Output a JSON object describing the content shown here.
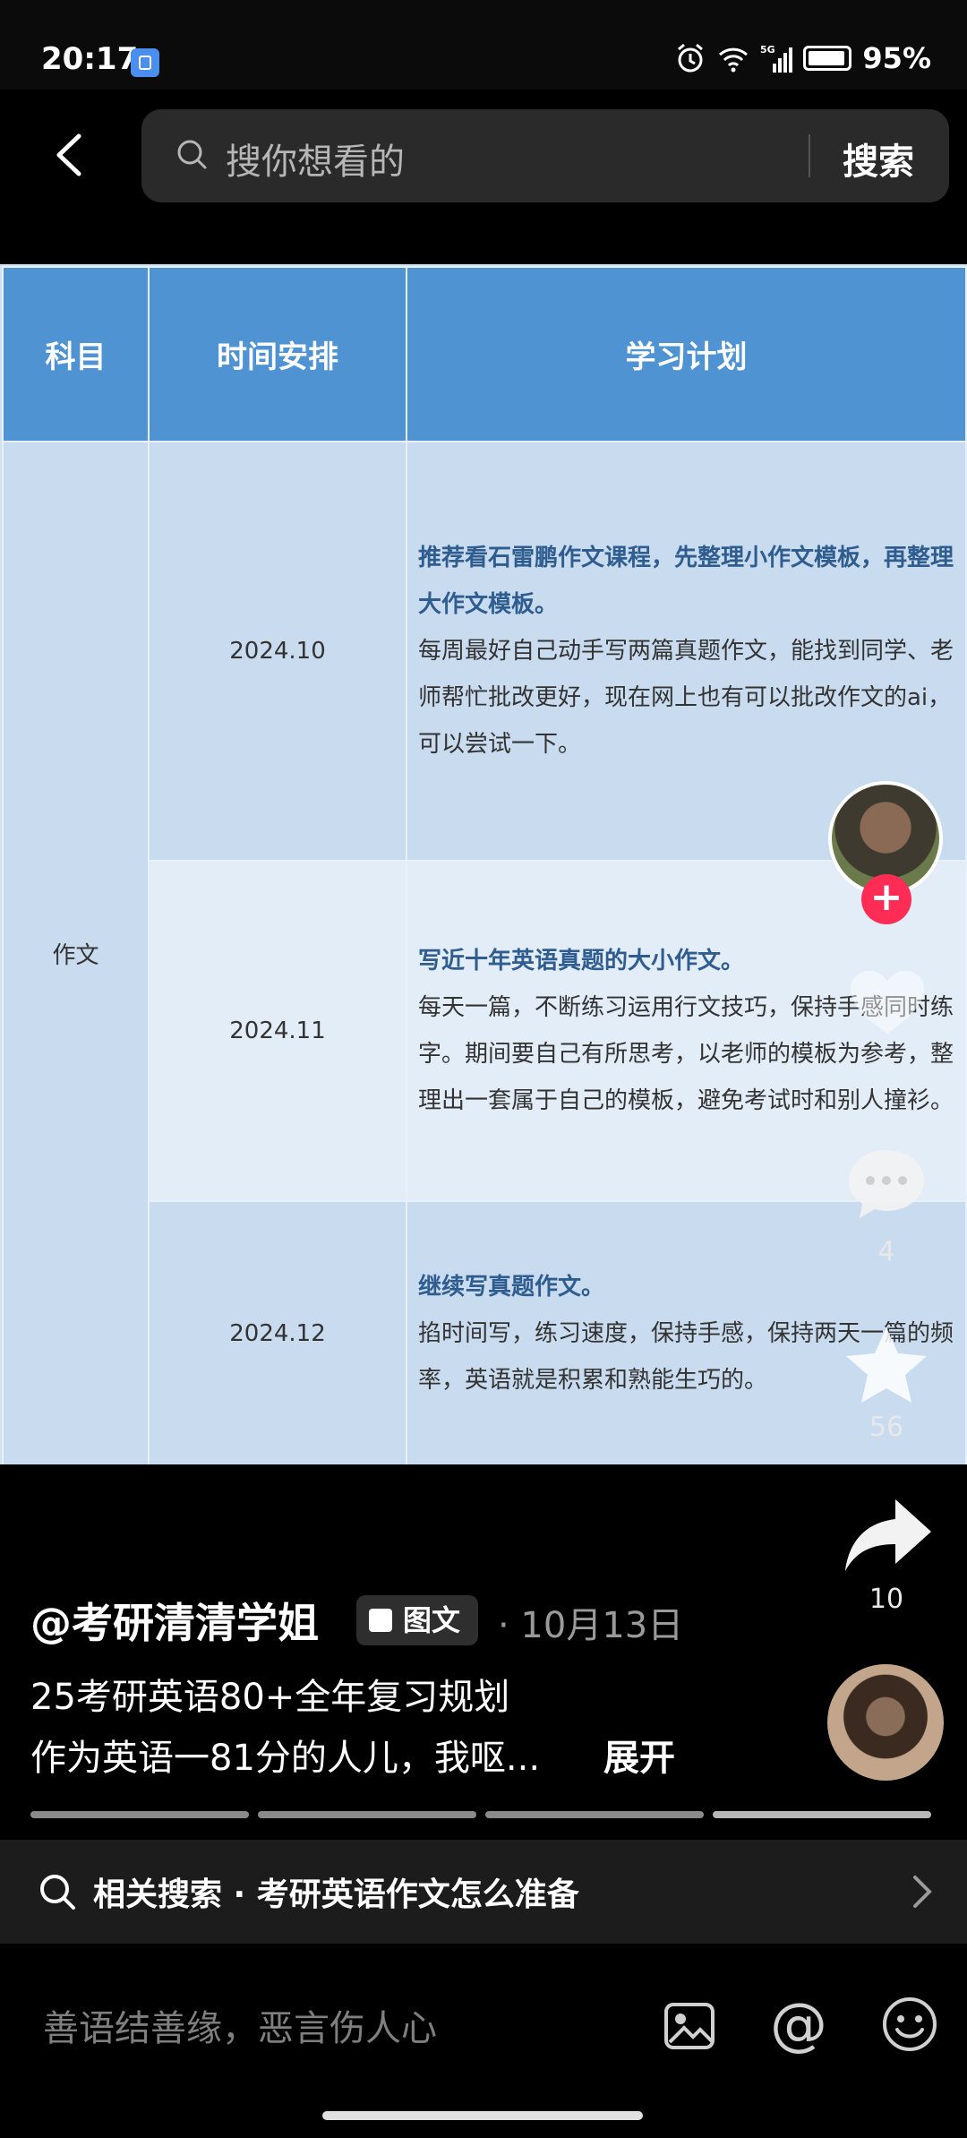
{
  "status": {
    "time": "20:17",
    "battery": "95%",
    "network": "5G"
  },
  "search": {
    "placeholder": "搜你想看的",
    "button": "搜索"
  },
  "table": {
    "headers": [
      "科目",
      "时间安排",
      "学习计划"
    ],
    "subject": "作文",
    "rows": [
      {
        "date": "2024.10",
        "plan_head": "推荐看石雷鹏作文课程，先整理小作文模板，再整理大作文模板。",
        "plan_body": "每周最好自己动手写两篇真题作文，能找到同学、老师帮忙批改更好，现在网上也有可以批改作文的ai，可以尝试一下。"
      },
      {
        "date": "2024.11",
        "plan_head": "写近十年英语真题的大小作文。",
        "plan_body": "每天一篇，不断练习运用行文技巧，保持手感同时练字。期间要自己有所思考，以老师的模板为参考，整理出一套属于自己的模板，避免考试时和别人撞衫。"
      },
      {
        "date": "2024.12",
        "plan_head": "继续写真题作文。",
        "plan_body": "掐时间写，练习速度，保持手感，保持两天一篇的频率，英语就是积累和熟能生巧的。"
      }
    ]
  },
  "actions": {
    "follow": "+",
    "likes": "",
    "comments": "4",
    "favorites": "56",
    "shares": "10"
  },
  "post": {
    "author": "@考研清清学姐",
    "type_badge": "图文",
    "date": "· 10月13日",
    "title": "25考研英语80+全年复习规划",
    "desc": "作为英语一81分的人儿，我呕...",
    "expand": "展开",
    "pages_total": 4,
    "page_current": 4
  },
  "related": {
    "label": "相关搜索 · 考研英语作文怎么准备"
  },
  "comment_bar": {
    "placeholder": "善语结善缘，恶言伤人心"
  },
  "colors": {
    "accent": "#ff2c55",
    "table_header": "#4f93d2",
    "plan_head": "#2f5d8f"
  }
}
